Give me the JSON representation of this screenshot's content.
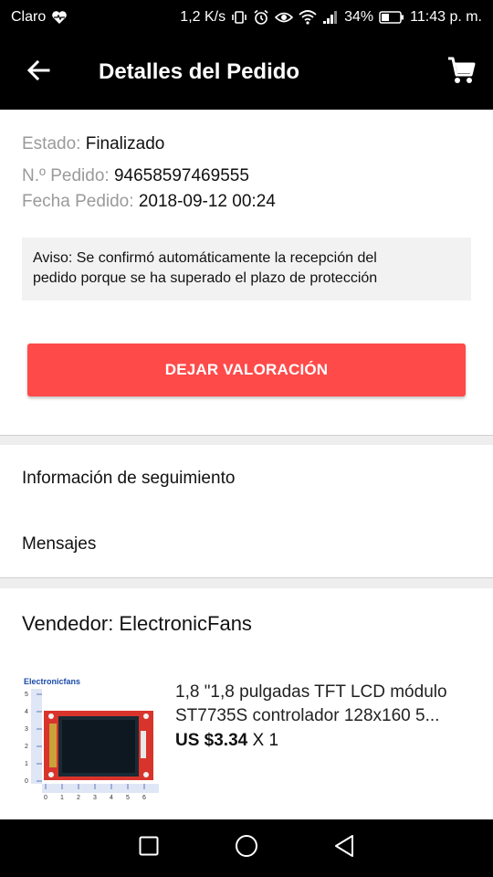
{
  "status_bar": {
    "carrier": "Claro",
    "speed": "1,2 K/s",
    "battery": "34%",
    "time": "11:43 p. m.",
    "icons": [
      "heart-pulse-icon",
      "vibrate-icon",
      "alarm-icon",
      "eye-icon",
      "wifi-icon",
      "signal-icon",
      "battery-icon"
    ]
  },
  "app_bar": {
    "title": "Detalles del Pedido",
    "back_icon": "arrow-back-icon",
    "cart_icon": "cart-icon"
  },
  "order": {
    "status_label": "Estado:",
    "status_value": "Finalizado",
    "number_label": "N.º Pedido:",
    "number_value": "94658597469555",
    "date_label": "Fecha Pedido:",
    "date_value": "2018-09-12 00:24",
    "notice_line1": "Aviso: Se confirmó automáticamente la recepción del",
    "notice_line2": "pedido porque se ha superado el plazo de protección",
    "rate_button": "DEJAR VALORACIÓN"
  },
  "menu": {
    "tracking": "Información de seguimiento",
    "messages": "Mensajes"
  },
  "seller": {
    "label": "Vendedor: ElectronicFans"
  },
  "product": {
    "title_line1": "1,8 \"1,8 pulgadas TFT LCD módulo",
    "title_line2": "ST7735S controlador 128x160 5...",
    "price": "US $3.34",
    "quantity": "X 1",
    "thumb_logo": "Electronicfans",
    "ruler_left": [
      "5",
      "4",
      "3",
      "2",
      "1",
      "0"
    ],
    "ruler_bottom": [
      "0",
      "1",
      "2",
      "3",
      "4",
      "5",
      "6"
    ]
  },
  "nav_bar": {
    "icons": [
      "recent-apps-icon",
      "home-icon",
      "back-icon"
    ]
  },
  "colors": {
    "accent": "#ff4a4a",
    "bar": "#000000",
    "label_gray": "#9a9a9a"
  }
}
